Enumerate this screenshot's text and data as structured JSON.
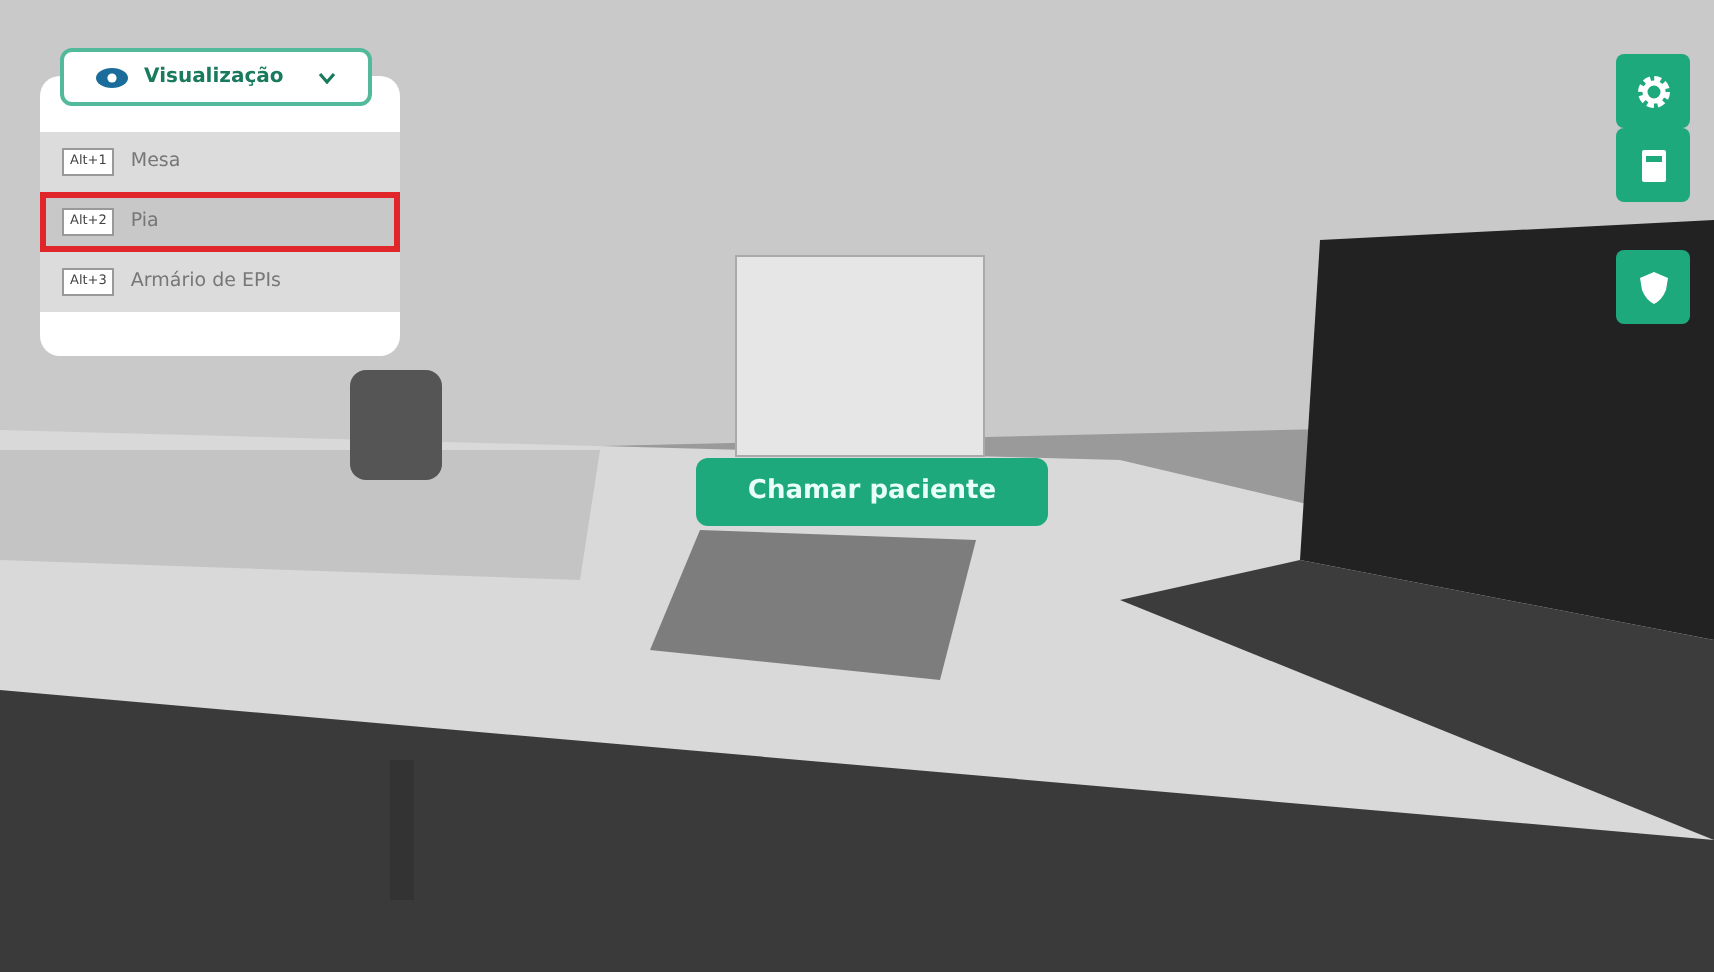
{
  "view_menu": {
    "title": "Visualização",
    "expanded": true,
    "items": [
      {
        "shortcut": "Alt+1",
        "label": "Mesa",
        "selected": false
      },
      {
        "shortcut": "Alt+2",
        "label": "Pia",
        "selected": true
      },
      {
        "shortcut": "Alt+3",
        "label": "Armário de EPIs",
        "selected": false
      }
    ]
  },
  "side_buttons": [
    {
      "kind": "settings"
    },
    {
      "kind": "document"
    },
    {
      "kind": "shield"
    }
  ],
  "call_button": "Chamar paciente"
}
